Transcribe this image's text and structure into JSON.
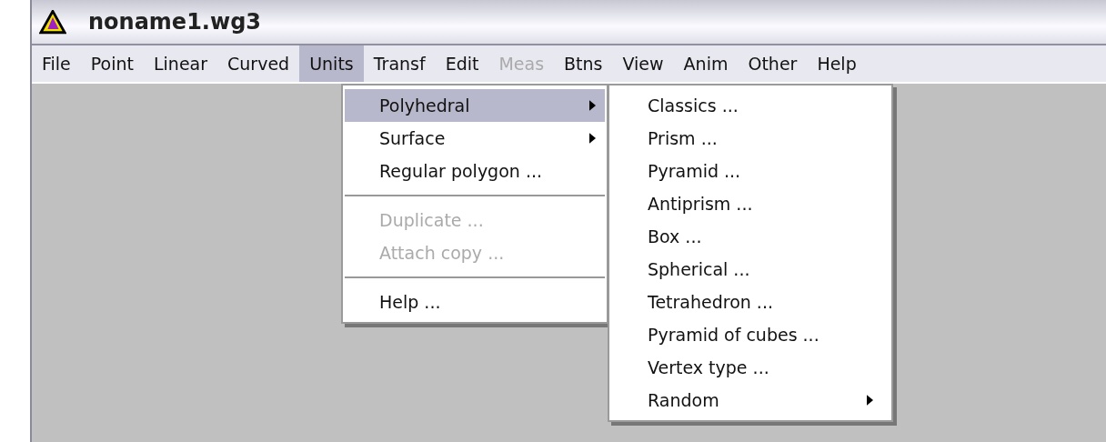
{
  "window": {
    "title": "noname1.wg3"
  },
  "menu_bar": [
    {
      "label": "File",
      "selected": false,
      "disabled": false
    },
    {
      "label": "Point",
      "selected": false,
      "disabled": false
    },
    {
      "label": "Linear",
      "selected": false,
      "disabled": false
    },
    {
      "label": "Curved",
      "selected": false,
      "disabled": false
    },
    {
      "label": "Units",
      "selected": true,
      "disabled": false
    },
    {
      "label": "Transf",
      "selected": false,
      "disabled": false
    },
    {
      "label": "Edit",
      "selected": false,
      "disabled": false
    },
    {
      "label": "Meas",
      "selected": false,
      "disabled": true
    },
    {
      "label": "Btns",
      "selected": false,
      "disabled": false
    },
    {
      "label": "View",
      "selected": false,
      "disabled": false
    },
    {
      "label": "Anim",
      "selected": false,
      "disabled": false
    },
    {
      "label": "Other",
      "selected": false,
      "disabled": false
    },
    {
      "label": "Help",
      "selected": false,
      "disabled": false
    }
  ],
  "units_menu": [
    {
      "kind": "item",
      "label": "Polyhedral",
      "selected": true,
      "disabled": false,
      "submenu": true
    },
    {
      "kind": "item",
      "label": "Surface",
      "selected": false,
      "disabled": false,
      "submenu": true
    },
    {
      "kind": "item",
      "label": "Regular polygon ...",
      "selected": false,
      "disabled": false,
      "submenu": false
    },
    {
      "kind": "separator"
    },
    {
      "kind": "item",
      "label": "Duplicate ...",
      "selected": false,
      "disabled": true,
      "submenu": false
    },
    {
      "kind": "item",
      "label": "Attach copy ...",
      "selected": false,
      "disabled": true,
      "submenu": false
    },
    {
      "kind": "separator"
    },
    {
      "kind": "item",
      "label": "Help ...",
      "selected": false,
      "disabled": false,
      "submenu": false
    }
  ],
  "polyhedral_submenu": [
    {
      "kind": "item",
      "label": "Classics ...",
      "selected": false,
      "disabled": false,
      "submenu": false
    },
    {
      "kind": "item",
      "label": "Prism ...",
      "selected": false,
      "disabled": false,
      "submenu": false
    },
    {
      "kind": "item",
      "label": "Pyramid ...",
      "selected": false,
      "disabled": false,
      "submenu": false
    },
    {
      "kind": "item",
      "label": "Antiprism ...",
      "selected": false,
      "disabled": false,
      "submenu": false
    },
    {
      "kind": "item",
      "label": "Box ...",
      "selected": false,
      "disabled": false,
      "submenu": false
    },
    {
      "kind": "item",
      "label": "Spherical ...",
      "selected": false,
      "disabled": false,
      "submenu": false
    },
    {
      "kind": "item",
      "label": "Tetrahedron ...",
      "selected": false,
      "disabled": false,
      "submenu": false
    },
    {
      "kind": "item",
      "label": "Pyramid of cubes ...",
      "selected": false,
      "disabled": false,
      "submenu": false
    },
    {
      "kind": "item",
      "label": "Vertex type ...",
      "selected": false,
      "disabled": false,
      "submenu": false
    },
    {
      "kind": "item",
      "label": "Random",
      "selected": false,
      "disabled": false,
      "submenu": true
    }
  ]
}
